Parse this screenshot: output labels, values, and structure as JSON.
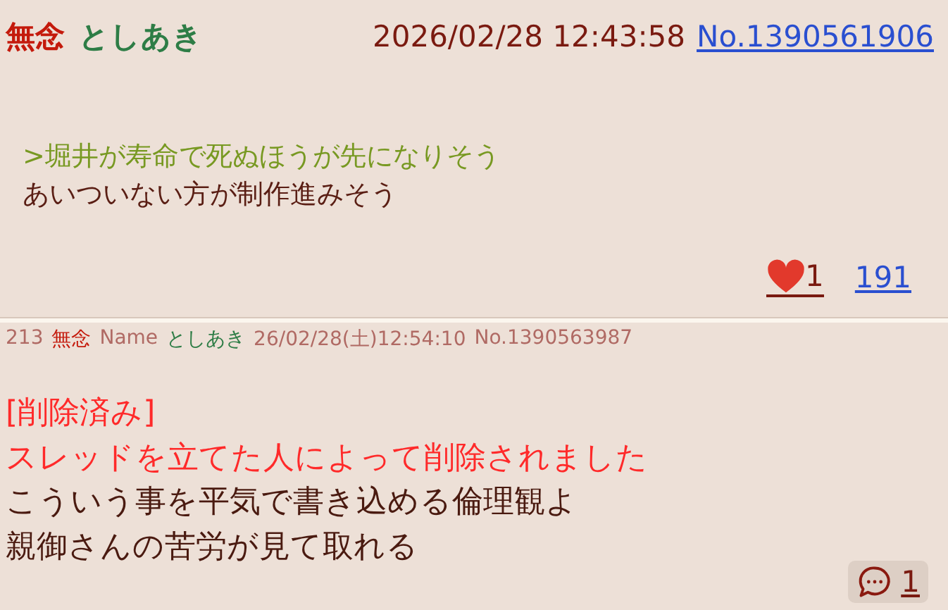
{
  "posts": [
    {
      "kind": "main",
      "subject": "無念",
      "name": "としあき",
      "datetime": "2026/02/28 12:43:58",
      "post_no": "No.1390561906",
      "lines": [
        {
          "kind": "quote",
          "text": ">堀井が寿命で死ぬほうが先になりそう"
        },
        {
          "kind": "text",
          "text": "あいついない方が制作進みそう"
        }
      ],
      "likes": "1",
      "views": "191"
    },
    {
      "kind": "reply",
      "number": "213",
      "subject": "無念",
      "name_label": "Name",
      "name": "としあき",
      "datetime": "26/02/28(土)12:54:10",
      "post_no": "No.1390563987",
      "lines": [
        {
          "kind": "deleted",
          "text": "[削除済み]"
        },
        {
          "kind": "deleted",
          "text": "スレッドを立てた人によって削除されました"
        },
        {
          "kind": "text",
          "text": "こういう事を平気で書き込める倫理観よ"
        },
        {
          "kind": "text",
          "text": "親御さんの苦労が見て取れる"
        }
      ],
      "replies": "1"
    }
  ]
}
